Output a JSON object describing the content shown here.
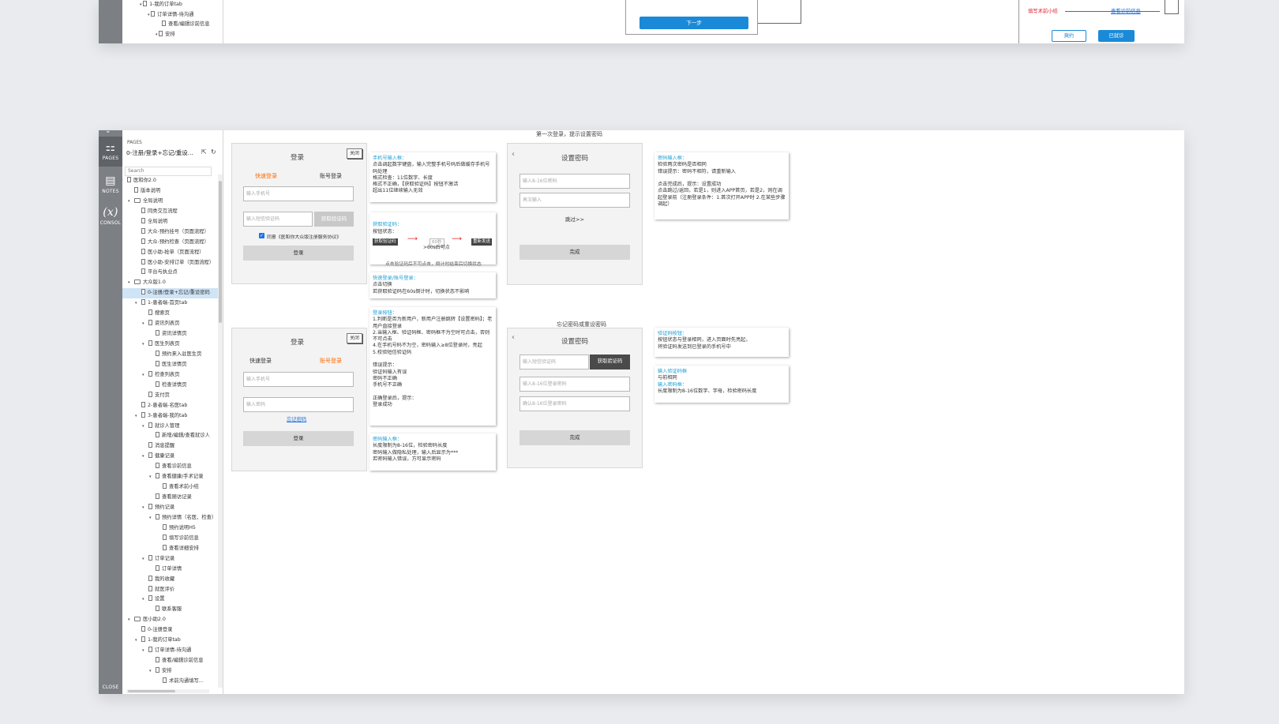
{
  "top": {
    "tree": [
      "1-我的订单tab",
      "订单详情-待沟通",
      "查看/编辑诊前信息",
      "安排"
    ],
    "next_btn": "下一步",
    "red_link": "填写术前小结",
    "blue_link": "查看诊前信息",
    "btn_outline": "爽约",
    "btn_blue": "已就诊"
  },
  "leftbar": {
    "pages": "PAGES",
    "notes": "NOTES",
    "console": "CONSOL",
    "close": "CLOSE"
  },
  "pages_panel": {
    "label": "PAGES",
    "current_page": "0-注册/登录+忘记/重设...",
    "search_placeholder": "Search",
    "tree": [
      {
        "label": "医和你2.0",
        "d": 0,
        "f": false,
        "a": "v"
      },
      {
        "label": "版本说明",
        "d": 1,
        "f": false,
        "a": ""
      },
      {
        "label": "全局说明",
        "d": 1,
        "f": true,
        "a": "v"
      },
      {
        "label": "同类交互流程",
        "d": 2,
        "f": false,
        "a": ""
      },
      {
        "label": "全局说明",
        "d": 2,
        "f": false,
        "a": ""
      },
      {
        "label": "大众-预约挂号（页面流程）",
        "d": 2,
        "f": false,
        "a": ""
      },
      {
        "label": "大众-预约检查（页面流程）",
        "d": 2,
        "f": false,
        "a": ""
      },
      {
        "label": "医小助-抢单（页面流程）",
        "d": 2,
        "f": false,
        "a": ""
      },
      {
        "label": "医小助-安排订单（页面流程）",
        "d": 2,
        "f": false,
        "a": ""
      },
      {
        "label": "平台与执业点",
        "d": 2,
        "f": false,
        "a": ""
      },
      {
        "label": "大众版1.0",
        "d": 1,
        "f": true,
        "a": "v"
      },
      {
        "label": "0-注册/登录+忘记/重设密码",
        "d": 2,
        "f": false,
        "a": "",
        "sel": true
      },
      {
        "label": "1-患者端-首页tab",
        "d": 2,
        "f": false,
        "a": "v"
      },
      {
        "label": "搜索页",
        "d": 3,
        "f": false,
        "a": ""
      },
      {
        "label": "资讯列表页",
        "d": 3,
        "f": false,
        "a": "v"
      },
      {
        "label": "资讯详情页",
        "d": 4,
        "f": false,
        "a": ""
      },
      {
        "label": "医生列表页",
        "d": 3,
        "f": false,
        "a": "v"
      },
      {
        "label": "预约来入驻医生页",
        "d": 4,
        "f": false,
        "a": ""
      },
      {
        "label": "医生详情页",
        "d": 4,
        "f": false,
        "a": ""
      },
      {
        "label": "检查列表页",
        "d": 3,
        "f": false,
        "a": "v"
      },
      {
        "label": "检查详情页",
        "d": 4,
        "f": false,
        "a": ""
      },
      {
        "label": "支付页",
        "d": 3,
        "f": false,
        "a": ""
      },
      {
        "label": "2-患者端-名医tab",
        "d": 2,
        "f": false,
        "a": ""
      },
      {
        "label": "3-患者端-我的tab",
        "d": 2,
        "f": false,
        "a": "v"
      },
      {
        "label": "就诊人管理",
        "d": 3,
        "f": false,
        "a": "v"
      },
      {
        "label": "新增/编辑/查看就诊人",
        "d": 4,
        "f": false,
        "a": ""
      },
      {
        "label": "消息提醒",
        "d": 3,
        "f": false,
        "a": ""
      },
      {
        "label": "健康记录",
        "d": 3,
        "f": false,
        "a": "v"
      },
      {
        "label": "查看诊前信息",
        "d": 4,
        "f": false,
        "a": ""
      },
      {
        "label": "查看健康/手术记录",
        "d": 4,
        "f": false,
        "a": "v"
      },
      {
        "label": "查看术前小结",
        "d": 5,
        "f": false,
        "a": ""
      },
      {
        "label": "查看随访记录",
        "d": 4,
        "f": false,
        "a": ""
      },
      {
        "label": "预约记录",
        "d": 3,
        "f": false,
        "a": "v"
      },
      {
        "label": "预约详情（名医、检查）",
        "d": 4,
        "f": false,
        "a": "v"
      },
      {
        "label": "预约说明H5",
        "d": 5,
        "f": false,
        "a": ""
      },
      {
        "label": "填写诊前信息",
        "d": 5,
        "f": false,
        "a": ""
      },
      {
        "label": "查看详细安排",
        "d": 5,
        "f": false,
        "a": ""
      },
      {
        "label": "订单记录",
        "d": 3,
        "f": false,
        "a": "v"
      },
      {
        "label": "订单详情",
        "d": 4,
        "f": false,
        "a": ""
      },
      {
        "label": "我的收藏",
        "d": 3,
        "f": false,
        "a": ""
      },
      {
        "label": "就医评价",
        "d": 3,
        "f": false,
        "a": ""
      },
      {
        "label": "设置",
        "d": 3,
        "f": false,
        "a": "v"
      },
      {
        "label": "联系客服",
        "d": 4,
        "f": false,
        "a": ""
      },
      {
        "label": "医小助2.0",
        "d": 1,
        "f": true,
        "a": "v"
      },
      {
        "label": "0-注册登录",
        "d": 2,
        "f": false,
        "a": ""
      },
      {
        "label": "1-我的订单tab",
        "d": 2,
        "f": false,
        "a": "v"
      },
      {
        "label": "订单详情-待沟通",
        "d": 3,
        "f": false,
        "a": "v"
      },
      {
        "label": "查看/编辑诊前信息",
        "d": 4,
        "f": false,
        "a": ""
      },
      {
        "label": "安排",
        "d": 4,
        "f": false,
        "a": "v"
      },
      {
        "label": "术前沟通填写...",
        "d": 5,
        "f": false,
        "a": ""
      }
    ]
  },
  "canvas": {
    "caption_first": "第一次登录，提示设置密码",
    "caption_forgot": "忘记密码或重设密码",
    "login1": {
      "title": "登录",
      "close": "关闭",
      "tab_quick": "快速登录",
      "tab_account": "账号登录",
      "phone_ph": "输入手机号",
      "code_ph": "输入短信验证码",
      "get_code": "获取验证码",
      "agree": "同意《医和你大众版注册服务协议》",
      "submit": "登录"
    },
    "login2": {
      "title": "登录",
      "close": "关闭",
      "tab_quick": "快速登录",
      "tab_account": "账号登录",
      "phone_ph": "输入手机号",
      "pwd_ph": "输入密码",
      "forgot": "忘记密码",
      "submit": "登录"
    },
    "setpwd1": {
      "title": "设置密码",
      "pwd_ph": "输入8-16位密码",
      "confirm_ph": "再次输入",
      "skip": "跳过>>",
      "done": "完成"
    },
    "setpwd2": {
      "title": "设置密码",
      "code_ph": "输入短信验证码",
      "get_code": "获取验证码",
      "pwd_ph": "输入8-16位登录密码",
      "confirm_ph": "确认8-16位登录密码",
      "done": "完成"
    },
    "notes": {
      "n1_h": "手机号输入框：",
      "n1_b": "点击调起数字键盘，输入完整手机号码后做缓存手机号码处理\n格式检查：11位数字、长度\n格式不正确，【获取验证码】按钮不激活\n超出11位继续输入无效",
      "n2_h": "获取验证码：",
      "n2_b": "按钮状态：",
      "n2_tag1": "获取验证码",
      "n2_tag2": "60秒",
      "n2_tag3": "重新发送",
      "n2_after": ">60s后可点",
      "n2_foot": "点击验证码后不可点击，倒计时结束后切换状态",
      "n3_h": "快速登录/账号登录：",
      "n3_b": "点击切换\n若获取验证码在60s倒计时，切换状态不影响",
      "n4_h": "登录按钮：",
      "n4_b": "1.判断是否为新用户，新用户注册跳转【设置密码】；老用户直接登录\n2.当输入框、验证码框、密码框不为空时可点击，否则不可点击\n4.在手机号码不为空，密码输入≥8位登录时，亮起\n5.校验短信验证码\n\n错误提示：\n验证码输入有误\n密码不正确\n手机号不正确\n\n正确登录后，提示：\n登录成功",
      "n5_h": "密码输入框：",
      "n5_b": "长度限制为8-16位，检验密码长度\n密码输入做隐私处理，输入后显示为***\n若密码输入错误，方可显示密码",
      "n6_h": "密码输入框：",
      "n6_b": "检验两次密码是否相同\n错误提示：密码不相符，请重新输入\n\n点击完成后，提示：设置成功\n点击跳过/返回，若是1，则进入APP首页，若是2，则在调起登录前（注册登录条件：1.首次打开APP时 2.在某些步骤调起）",
      "n7_h": "验证码按钮：",
      "n7_b": "按钮状态与登录相同，进入页面时先亮起，\n将验证码发送到已登录的手机号中",
      "n8_h1": "输入验证码框",
      "n8_b1": "与前相同",
      "n8_h2": "输入密码框：",
      "n8_b2": "长度限制为8-16位数字、字母，检验密码长度"
    }
  }
}
